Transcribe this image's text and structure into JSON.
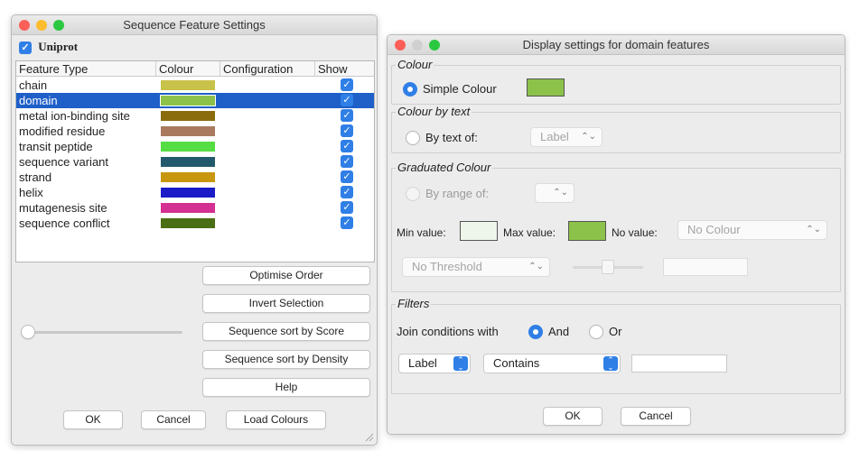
{
  "window1": {
    "title": "Sequence Feature Settings",
    "source_label": "Uniprot",
    "columns": [
      "Feature Type",
      "Colour",
      "Configuration",
      "Show"
    ],
    "rows": [
      {
        "name": "chain",
        "color": "#c8c24a",
        "selected": false
      },
      {
        "name": "domain",
        "color": "#8cc24a",
        "selected": true
      },
      {
        "name": "metal ion-binding site",
        "color": "#8b6c0c",
        "selected": false
      },
      {
        "name": "modified residue",
        "color": "#a97a5e",
        "selected": false
      },
      {
        "name": "transit peptide",
        "color": "#55dd44",
        "selected": false
      },
      {
        "name": "sequence variant",
        "color": "#235a6b",
        "selected": false
      },
      {
        "name": "strand",
        "color": "#c9960f",
        "selected": false
      },
      {
        "name": "helix",
        "color": "#1b1bc7",
        "selected": false
      },
      {
        "name": "mutagenesis site",
        "color": "#d42f92",
        "selected": false
      },
      {
        "name": "sequence conflict",
        "color": "#4a6e13",
        "selected": false
      }
    ],
    "buttons": {
      "optimise": "Optimise Order",
      "invert": "Invert Selection",
      "sort_score": "Sequence sort by Score",
      "sort_density": "Sequence sort by Density",
      "help": "Help",
      "ok": "OK",
      "cancel": "Cancel",
      "load": "Load Colours"
    },
    "transparency_slider": 0
  },
  "window2": {
    "title": "Display settings for domain features",
    "colour_group": "Colour",
    "simple_colour_label": "Simple Colour",
    "simple_colour": "#8cc24a",
    "colour_by_text_group": "Colour by text",
    "by_text_label": "By text of:",
    "by_text_value": "Label",
    "graduated_group": "Graduated Colour",
    "by_range_label": "By range of:",
    "min_label": "Min value:",
    "min_colour": "#eef5ea",
    "max_label": "Max value:",
    "max_colour": "#8cc24a",
    "no_value_label": "No value:",
    "no_value_select": "No Colour",
    "threshold_select": "No Threshold",
    "filters_group": "Filters",
    "join_label": "Join conditions with",
    "and_label": "And",
    "or_label": "Or",
    "filter_attribute": "Label",
    "filter_condition": "Contains",
    "ok": "OK",
    "cancel": "Cancel"
  }
}
